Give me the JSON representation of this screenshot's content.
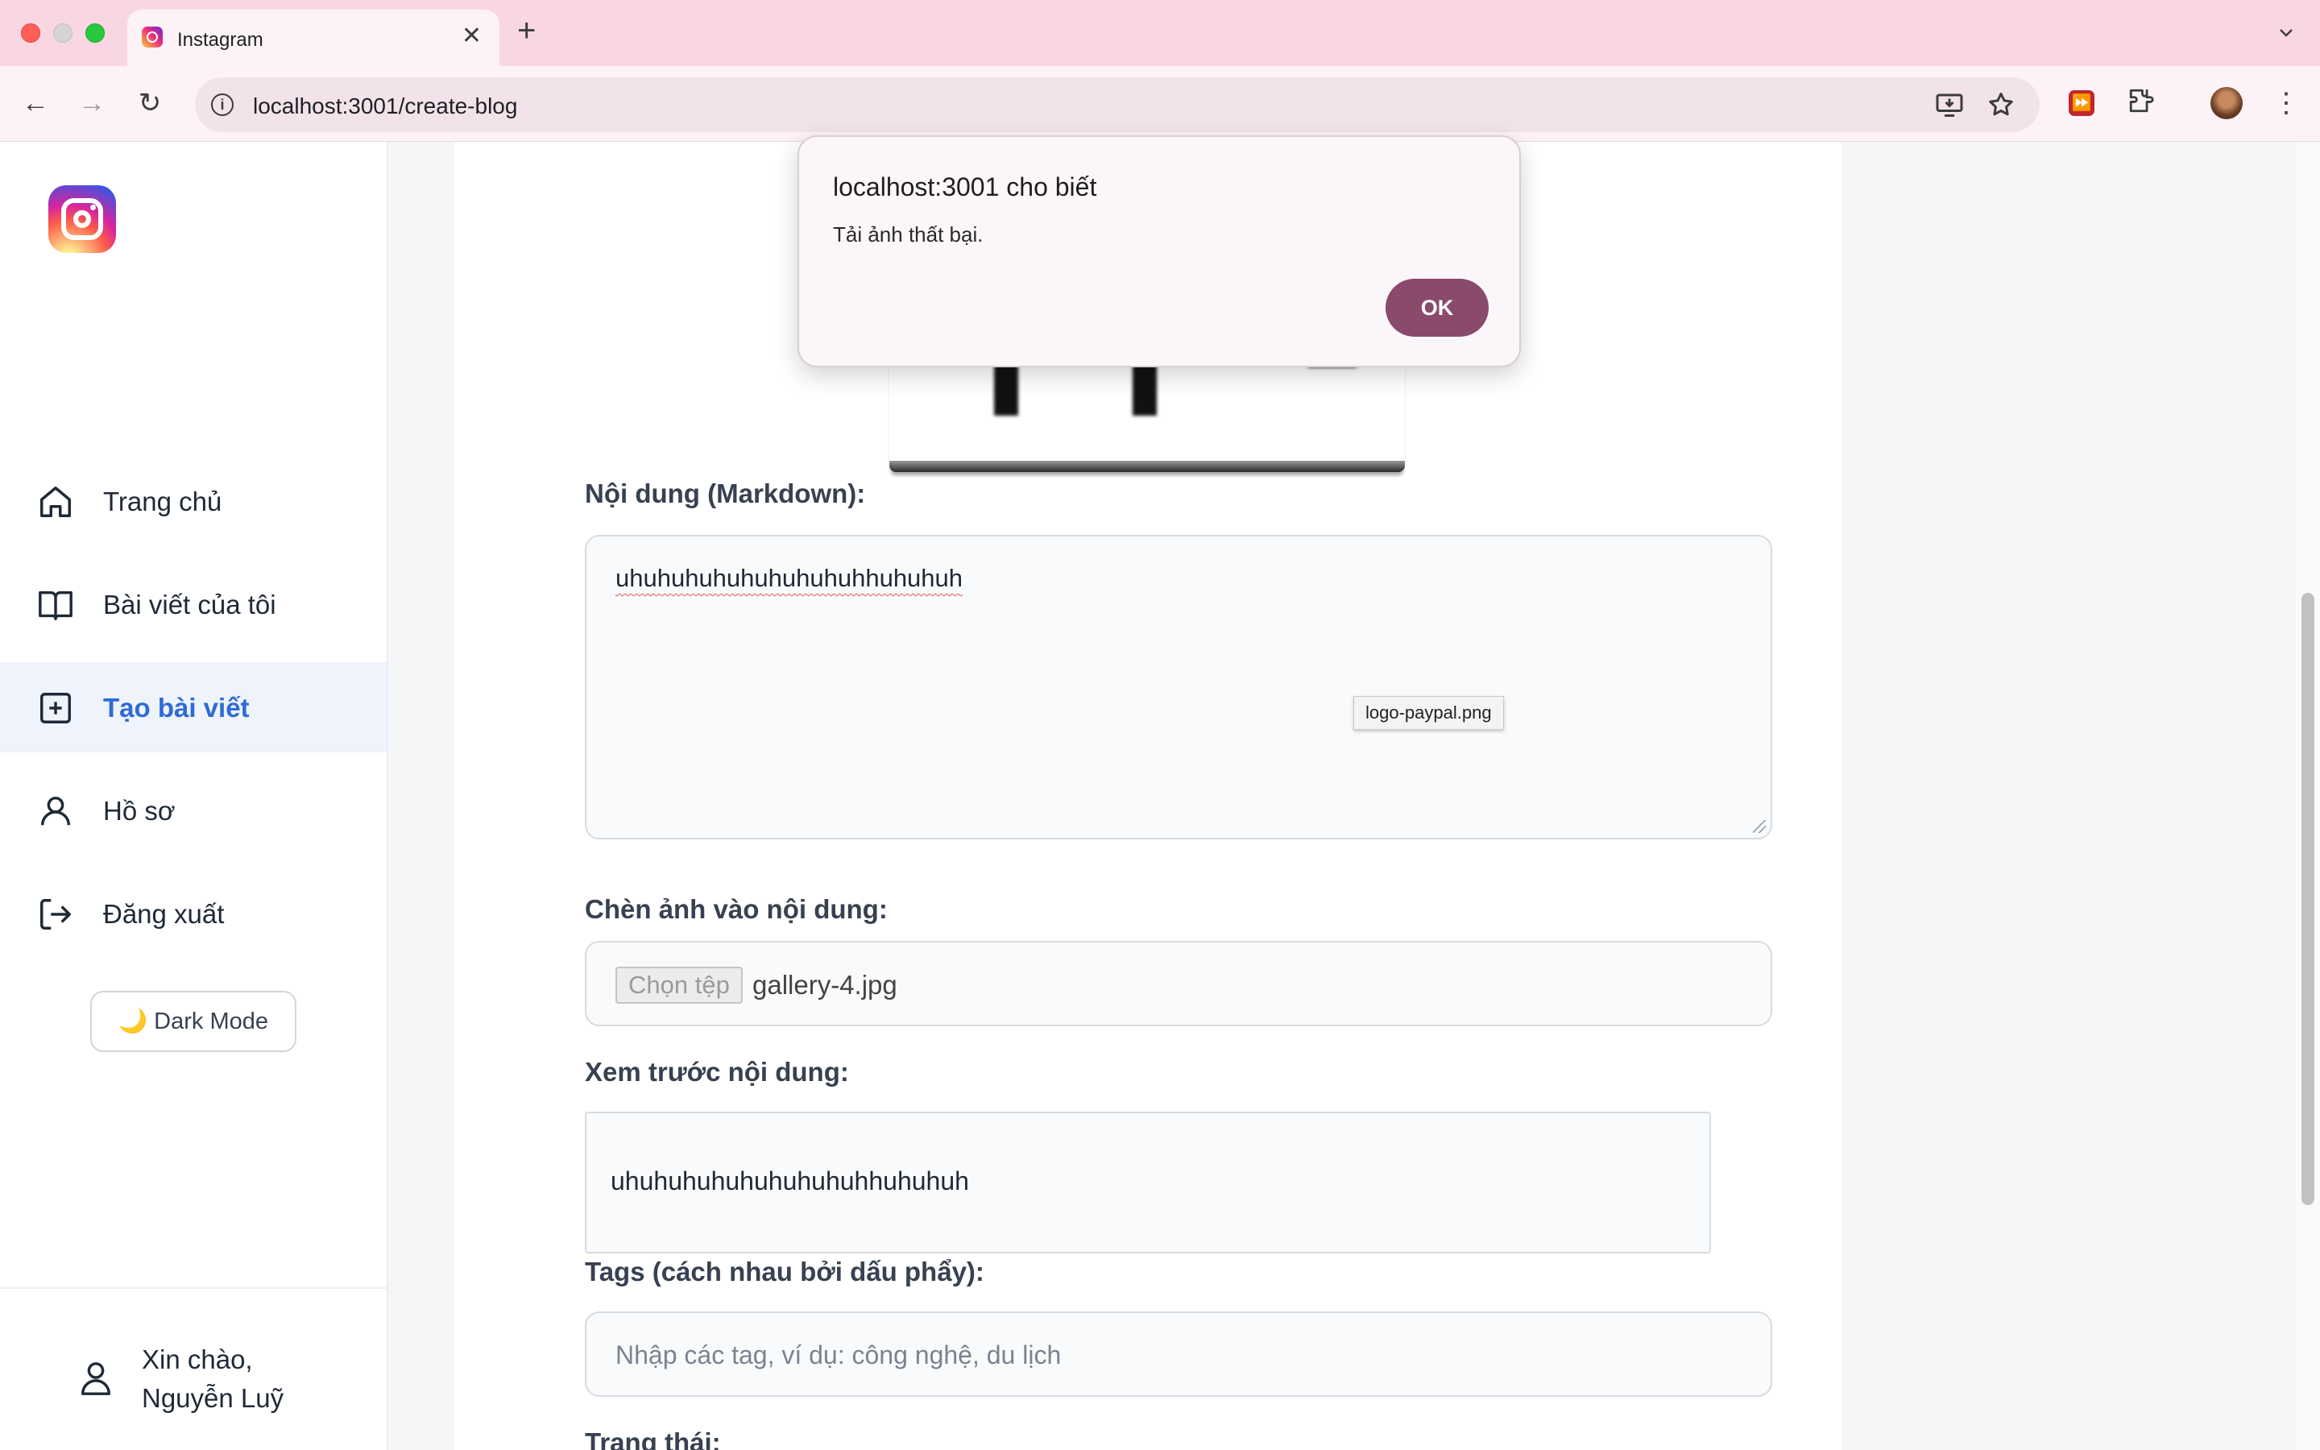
{
  "browser": {
    "tab_title": "Instagram",
    "tab_close": "✕",
    "new_tab": "+",
    "tab_menu": "⌄",
    "url": "localhost:3001/create-blog",
    "back": "←",
    "forward": "→",
    "reload": "↻",
    "menu": "⋮"
  },
  "sidebar": {
    "items": [
      {
        "label": "Trang chủ",
        "icon": "home-icon"
      },
      {
        "label": "Bài viết của tôi",
        "icon": "book-icon"
      },
      {
        "label": "Tạo bài viết",
        "icon": "plus-square-icon",
        "active": true
      },
      {
        "label": "Hồ sơ",
        "icon": "user-icon"
      },
      {
        "label": "Đăng xuất",
        "icon": "logout-icon"
      }
    ],
    "dark_mode_label": "🌙 Dark Mode",
    "greeting_line1": "Xin chào,",
    "greeting_line2": "Nguyễn Luỹ"
  },
  "form": {
    "content_label": "Nội dung (Markdown):",
    "content_value": "uhuhuhuhuhuhuhuhuhhuhuhuh",
    "insert_image_label": "Chèn ảnh vào nội dung:",
    "file_button": "Chọn tệp",
    "file_name": "gallery-4.jpg",
    "preview_label": "Xem trước nội dung:",
    "preview_text": "uhuhuhuhuhuhuhuhuhhuhuhuh",
    "tags_label": "Tags (cách nhau bởi dấu phẩy):",
    "tags_placeholder": "Nhập các tag, ví dụ: công nghệ, du lịch",
    "status_label": "Trạng thái:"
  },
  "tooltip": "logo-paypal.png",
  "dialog": {
    "title": "localhost:3001 cho biết",
    "message": "Tải ảnh thất bại.",
    "ok": "OK"
  },
  "colors": {
    "accent": "#2f6bd3",
    "active_bg": "#eef3fc",
    "dialog_button": "#8a4a6b",
    "tab_strip": "#f8d7e3"
  }
}
